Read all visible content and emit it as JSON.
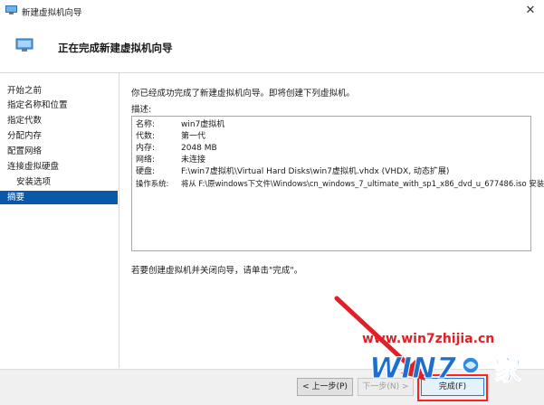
{
  "window": {
    "title": "新建虚拟机向导",
    "close_glyph": "✕"
  },
  "header": {
    "title": "正在完成新建虚拟机向导"
  },
  "nav": {
    "items": [
      {
        "label": "开始之前",
        "sub": false,
        "active": false
      },
      {
        "label": "指定名称和位置",
        "sub": false,
        "active": false
      },
      {
        "label": "指定代数",
        "sub": false,
        "active": false
      },
      {
        "label": "分配内存",
        "sub": false,
        "active": false
      },
      {
        "label": "配置网络",
        "sub": false,
        "active": false
      },
      {
        "label": "连接虚拟硬盘",
        "sub": false,
        "active": false
      },
      {
        "label": "安装选项",
        "sub": true,
        "active": false
      },
      {
        "label": "摘要",
        "sub": false,
        "active": true
      }
    ]
  },
  "main": {
    "intro": "你已经成功完成了新建虚拟机向导。即将创建下列虚拟机。",
    "description_label": "描述:",
    "summary": [
      {
        "key": "名称:",
        "value": "win7虚拟机"
      },
      {
        "key": "代数:",
        "value": "第一代"
      },
      {
        "key": "内存:",
        "value": "2048 MB"
      },
      {
        "key": "网络:",
        "value": "未连接"
      },
      {
        "key": "硬盘:",
        "value": "F:\\win7虚拟机\\Virtual Hard Disks\\win7虚拟机.vhdx (VHDX, 动态扩展)"
      },
      {
        "key": "操作系统:",
        "value": "将从 F:\\原windows下文件\\Windows\\cn_windows_7_ultimate_with_sp1_x86_dvd_u_677486.iso 安装"
      }
    ],
    "hint": "若要创建虚拟机并关闭向导，请单击\"完成\"。"
  },
  "buttons": {
    "prev": "< 上一步(P)",
    "next": "下一步(N) >",
    "finish": "完成(F)"
  },
  "watermark": {
    "url": "www.win7zhijia.cn",
    "logo_text": "WIN7",
    "logo_suffix": "家"
  },
  "colors": {
    "nav_active": "#0a58a8",
    "annotation": "#e21f26"
  }
}
